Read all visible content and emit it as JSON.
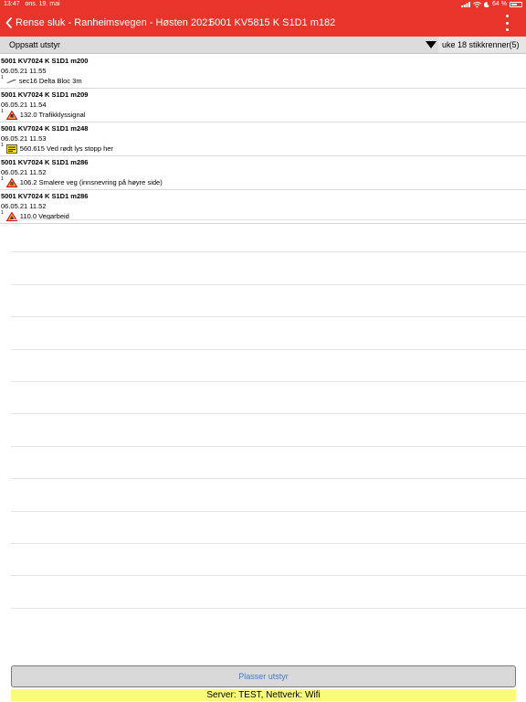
{
  "status": {
    "time": "13:47",
    "date": "ons. 19. mai",
    "battery": "64 %",
    "battery_level": 0.64
  },
  "nav": {
    "back_label": "Rense sluk - Ranheimsvegen - Høsten 2021",
    "title": "5001 KV5815 K S1D1 m182"
  },
  "toolbar": {
    "label": "Oppsatt utstyr",
    "select_value": "uke 18 stikkrenner(5)"
  },
  "items": [
    {
      "title": "5001 KV7024 K S1D1 m200",
      "date": "06.05.21 11.55",
      "sup": "1",
      "icon": "delta-bloc-icon",
      "desc": "sec16 Delta Bloc 3m"
    },
    {
      "title": "5001 KV7024 K S1D1 m209",
      "date": "06.05.21 11.54",
      "sup": "1",
      "icon": "warning-sign-icon",
      "desc": "132.0 Trafikklyssignal"
    },
    {
      "title": "5001 KV7024 K S1D1 m248",
      "date": "06.05.21 11.53",
      "sup": "1",
      "icon": "info-sign-icon",
      "desc": "560.615 Ved rødt lys stopp her"
    },
    {
      "title": "5001 KV7024 K S1D1 m286",
      "date": "06.05.21 11.52",
      "sup": "1",
      "icon": "warning-sign-icon",
      "desc": "106.2 Smalere veg (innsnevring på høyre side)"
    },
    {
      "title": "5001 KV7024 K S1D1 m286",
      "date": "06.05.21 11.52",
      "sup": "1",
      "icon": "warning-sign-icon",
      "desc": "110.0 Vegarbeid"
    }
  ],
  "place_button": "Plasser utstyr",
  "server_status": "Server: TEST, Nettverk: Wifi",
  "colors": {
    "accent": "#e8342b",
    "server_bar": "#fbfb7b",
    "button_text": "#4a78c8"
  }
}
